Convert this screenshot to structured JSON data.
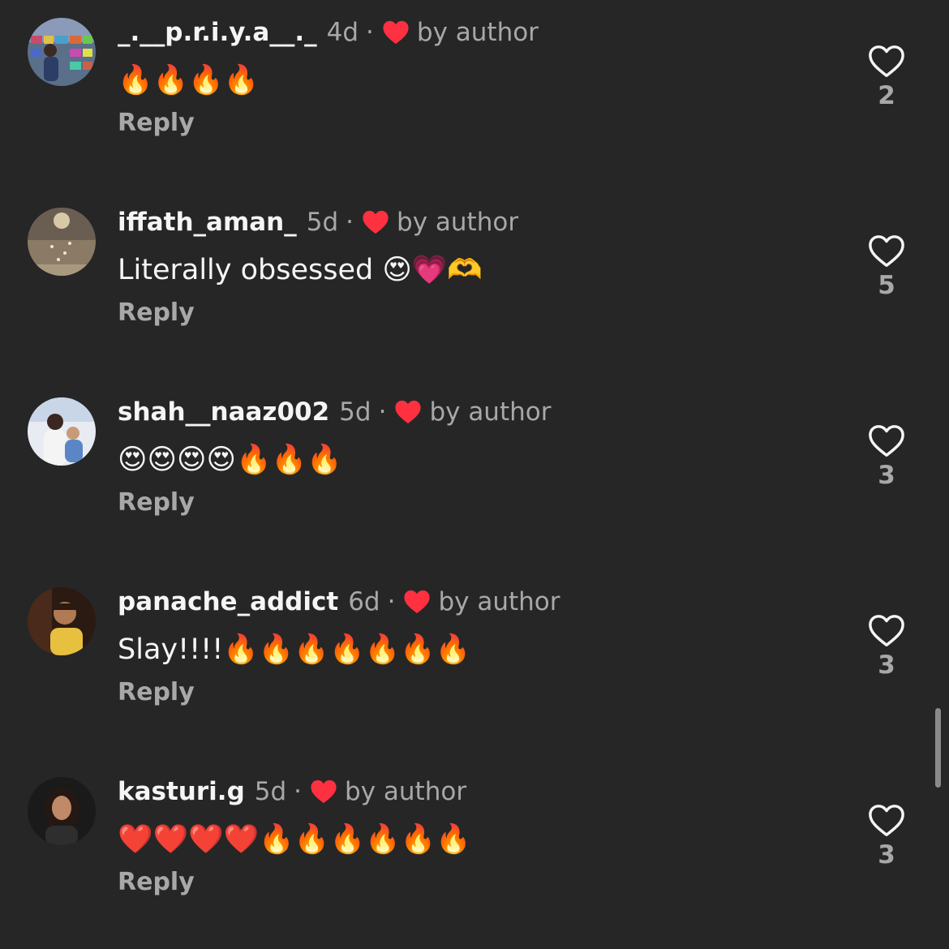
{
  "comments": [
    {
      "username": "_._​_p.r.i.y.a__._",
      "time": "4d",
      "dot": "·",
      "by_author": "by author",
      "text": "🔥🔥🔥🔥",
      "reply_label": "Reply",
      "likes": "2"
    },
    {
      "username": "iffath_aman_",
      "time": "5d",
      "dot": "·",
      "by_author": "by author",
      "text": "Literally obsessed 😍💗🫶",
      "reply_label": "Reply",
      "likes": "5"
    },
    {
      "username": "shah__naaz002",
      "time": "5d",
      "dot": "·",
      "by_author": "by author",
      "text": "😍😍😍😍🔥🔥🔥",
      "reply_label": "Reply",
      "likes": "3"
    },
    {
      "username": "panache_addict",
      "time": "6d",
      "dot": "·",
      "by_author": "by author",
      "text": "Slay!!!!🔥🔥🔥🔥🔥🔥🔥",
      "reply_label": "Reply",
      "likes": "3"
    },
    {
      "username": "kasturi.g",
      "time": "5d",
      "dot": "·",
      "by_author": "by author",
      "text": "❤️❤️❤️❤️🔥🔥🔥🔥🔥🔥",
      "reply_label": "Reply",
      "likes": "3"
    }
  ],
  "colors": {
    "background": "#262626",
    "primary_text": "#f5f5f5",
    "secondary_text": "#a8a8a8",
    "author_heart": "#ff3040"
  },
  "icons": {
    "author_like": "heart-filled-icon",
    "like": "heart-outline-icon"
  }
}
